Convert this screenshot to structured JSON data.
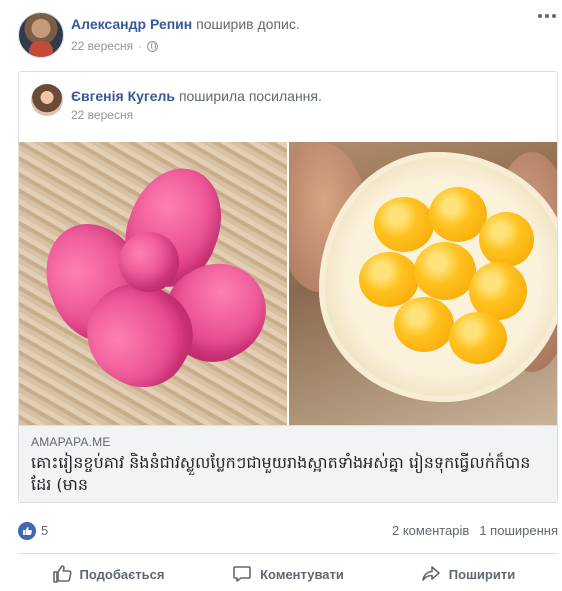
{
  "post": {
    "author": "Александр Репин",
    "action": "поширив допис.",
    "date": "22 вересня",
    "privacy_icon": "globe-icon"
  },
  "shared": {
    "author": "Євгенія Кугель",
    "action": "поширила",
    "object": "посилання.",
    "date": "22 вересня"
  },
  "link": {
    "domain": "AMAPAPA.ME",
    "title": "គោះរៀនខ្ចប់គាវ និងនំជាវស្លួលប្លែកៗជាមួយរាងស្អាតទាំងអស់គ្នា រៀនទុកធ្វើលក់ក៏បានដែរ (មាន"
  },
  "reactions": {
    "like_count": "5",
    "comments": "2 коментарів",
    "shares": "1 поширення"
  },
  "actions": {
    "like": "Подобається",
    "comment": "Коментувати",
    "share": "Поширити"
  },
  "colors": {
    "link_blue": "#385898",
    "like_blue": "#4267b2",
    "secondary_text": "#606770"
  }
}
